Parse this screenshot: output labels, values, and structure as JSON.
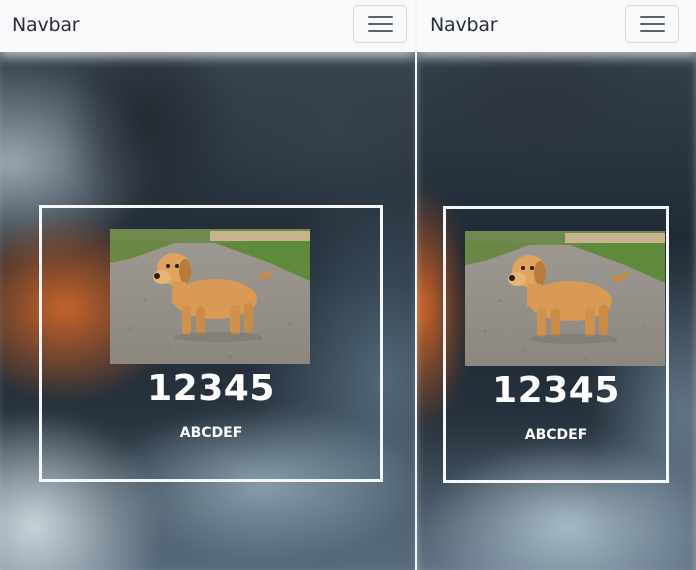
{
  "panels": [
    {
      "navbar": {
        "brand": "Navbar",
        "toggler_icon": "hamburger-menu-icon"
      },
      "card": {
        "image_subject": "puppy on gravel road",
        "number": "12345",
        "subtitle": "ABCDEF"
      }
    },
    {
      "navbar": {
        "brand": "Navbar",
        "toggler_icon": "hamburger-menu-icon"
      },
      "card": {
        "image_subject": "puppy on gravel road",
        "number": "12345",
        "subtitle": "ABCDEF"
      }
    }
  ],
  "colors": {
    "navbar_bg": "#f8f9fa",
    "card_border": "#f5f6f7",
    "card_text": "#ffffff"
  }
}
